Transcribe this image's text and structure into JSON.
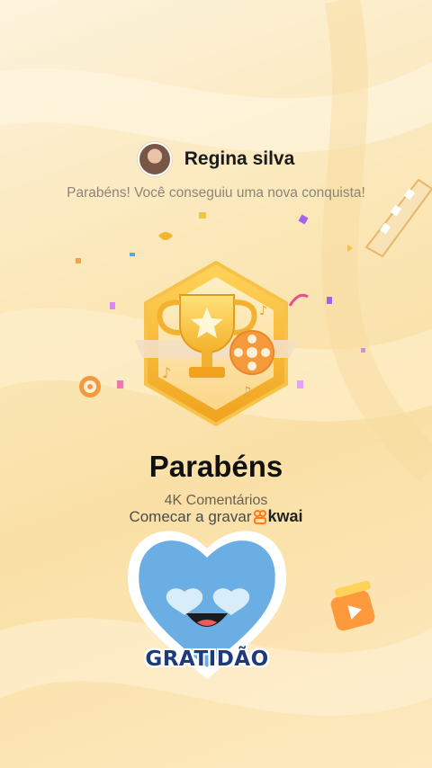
{
  "user": {
    "name": "Regina silva"
  },
  "message": {
    "subtitle": "Parabéns! Você conseguiu uma nova conquista!",
    "title": "Parabéns",
    "count": "4K Comentários",
    "record_prefix": "Comecar a gravar",
    "brand": "kwai"
  },
  "sticker": {
    "label": "GRATIDÃO",
    "heart_color": "#6aaee3"
  },
  "badge": {
    "icon": "trophy-icon",
    "hex_color": "#f4b93a"
  },
  "colors": {
    "accent_orange": "#ff7a1a",
    "text_dark": "#111111",
    "text_muted": "#8c8576"
  }
}
